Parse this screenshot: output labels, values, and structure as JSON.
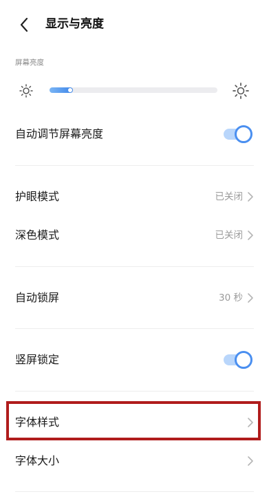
{
  "header": {
    "title": "显示与亮度"
  },
  "brightness": {
    "section_label": "屏幕亮度",
    "level_fraction": 0.14
  },
  "settings": {
    "auto_brightness": {
      "label": "自动调节屏幕亮度",
      "enabled": true
    },
    "eye_protection": {
      "label": "护眼模式",
      "value": "已关闭"
    },
    "dark_mode": {
      "label": "深色模式",
      "value": "已关闭"
    },
    "auto_lock": {
      "label": "自动锁屏",
      "value": "30 秒"
    },
    "portrait_lock": {
      "label": "竖屏锁定",
      "enabled": true
    },
    "font_style": {
      "label": "字体样式"
    },
    "font_size": {
      "label": "字体大小"
    }
  },
  "colors": {
    "accent": "#3f86e8",
    "highlight": "#b01c1c"
  }
}
